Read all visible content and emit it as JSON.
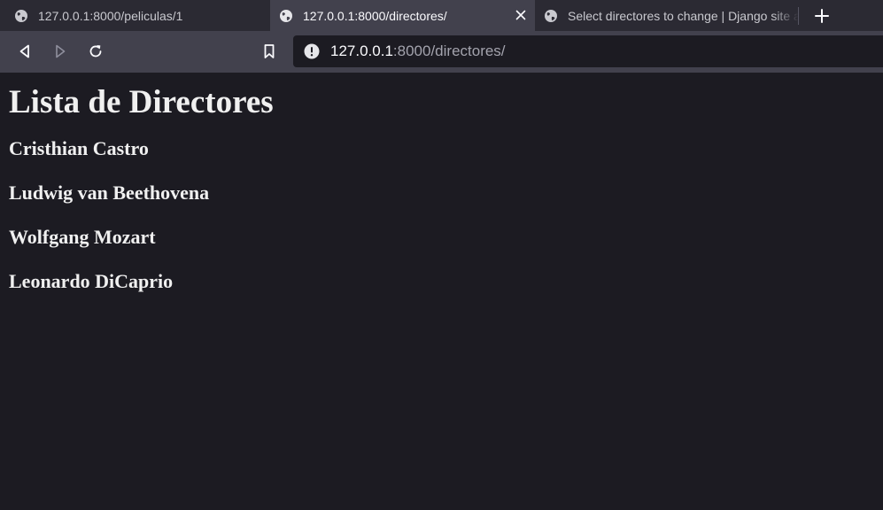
{
  "browser": {
    "tabs": [
      {
        "title": "127.0.0.1:8000/peliculas/1",
        "active": false,
        "icon": "globe-icon"
      },
      {
        "title": "127.0.0.1:8000/directores/",
        "active": true,
        "icon": "globe-icon"
      },
      {
        "title": "Select directores to change | Django site admin",
        "active": false,
        "icon": "globe-icon"
      }
    ],
    "address": {
      "host": "127.0.0.1",
      "rest": ":8000/directores/"
    },
    "colors": {
      "tabstrip": "#2b2a33",
      "toolbar": "#42414d",
      "page_bg": "#1c1b22",
      "text": "#f0f0f0"
    }
  },
  "page": {
    "title": "Lista de Directores",
    "directors": [
      "Cristhian Castro",
      "Ludwig van Beethovena",
      "Wolfgang Mozart",
      "Leonardo DiCaprio"
    ]
  }
}
